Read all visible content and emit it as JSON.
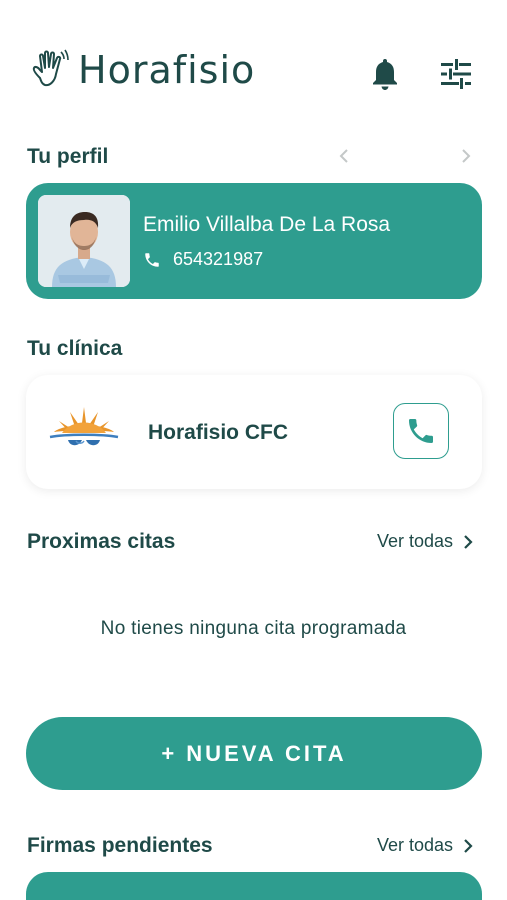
{
  "app": {
    "title": "Horafisio"
  },
  "icons": {
    "logo": "hand-logo-icon",
    "bell": "bell-icon",
    "filters": "tune-icon",
    "phone": "phone-icon",
    "chevron": "chevron-right-icon"
  },
  "colors": {
    "primary": "#2e9d8f",
    "text": "#1f4a48",
    "muted": "#c4c8c8"
  },
  "profile": {
    "section_title": "Tu perfil",
    "name": "Emilio Villalba De La Rosa",
    "phone": "654321987"
  },
  "clinic": {
    "section_title": "Tu clínica",
    "name": "Horafisio CFC"
  },
  "appointments": {
    "section_title": "Proximas citas",
    "see_all": "Ver todas",
    "empty_message": "No tienes ninguna cita programada"
  },
  "new_appointment_button": "+ NUEVA CITA",
  "signatures": {
    "section_title": "Firmas pendientes",
    "see_all": "Ver todas"
  }
}
